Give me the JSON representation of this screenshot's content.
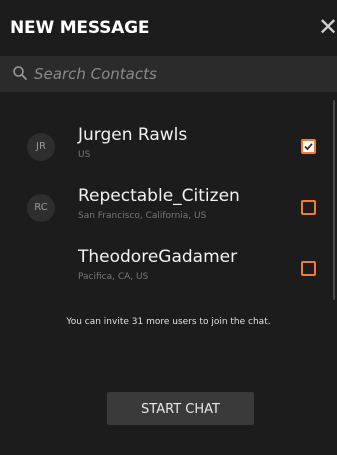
{
  "header": {
    "title": "NEW MESSAGE",
    "close_glyph": "✕"
  },
  "search": {
    "placeholder": "Search Contacts",
    "icon": "search-icon"
  },
  "contacts": [
    {
      "initials": "JR",
      "name": "Jurgen Rawls",
      "location": "US",
      "selected": true
    },
    {
      "initials": "RC",
      "name": "Repectable_Citizen",
      "location": "San Francisco, California, US",
      "selected": false
    },
    {
      "initials": "",
      "name": "TheodoreGadamer",
      "location": "Pacifica, CA, US",
      "selected": false
    }
  ],
  "invite_text": "You can invite 31 more users to join the chat.",
  "start_button": "START CHAT",
  "colors": {
    "accent": "#f07c38",
    "background": "#1c1c1c",
    "search_bg": "#2b2b2b",
    "button_bg": "#3a3a3a"
  }
}
